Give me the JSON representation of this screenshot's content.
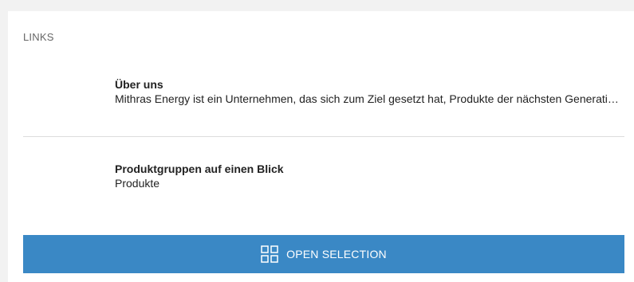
{
  "links": {
    "title": "LINKS",
    "items": [
      {
        "title": "Über uns",
        "description": "Mithras Energy ist ein Unternehmen, das sich zum Ziel gesetzt hat, Produkte der nächsten Generation zu entwickeln"
      },
      {
        "title": "Produktgruppen auf einen Blick",
        "description": "Produkte"
      }
    ],
    "open_button": {
      "label": "OPEN SELECTION",
      "icon": "grid-icon"
    }
  },
  "colors": {
    "page_background": "#f2f2f2",
    "panel_background": "#ffffff",
    "button_background": "#3a88c5",
    "button_text": "#ffffff"
  }
}
